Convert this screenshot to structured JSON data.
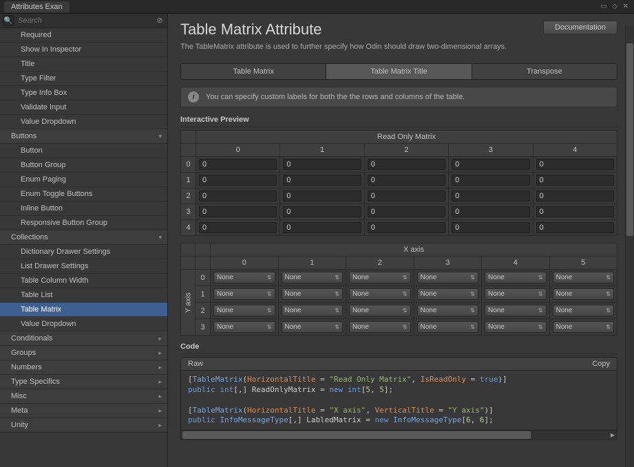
{
  "window": {
    "title": "Attributes Exan"
  },
  "search": {
    "placeholder": "Search"
  },
  "sidebar": {
    "topItems": [
      "Required",
      "Show In Inspector",
      "Title",
      "Type Filter",
      "Type Info Box",
      "Validate Input",
      "Value Dropdown"
    ],
    "groups": [
      {
        "name": "Buttons",
        "arrow": "▾",
        "items": [
          "Button",
          "Button Group",
          "Enum Paging",
          "Enum Toggle Buttons",
          "Inline Button",
          "Responsive Button Group"
        ]
      },
      {
        "name": "Collections",
        "arrow": "▾",
        "items": [
          "Dictionary Drawer Settings",
          "List Drawer Settings",
          "Table Column Width",
          "Table List",
          "Table Matrix",
          "Value Dropdown"
        ]
      },
      {
        "name": "Conditionals",
        "arrow": "▸",
        "items": []
      },
      {
        "name": "Groups",
        "arrow": "▸",
        "items": []
      },
      {
        "name": "Numbers",
        "arrow": "▸",
        "items": []
      },
      {
        "name": "Type Specifics",
        "arrow": "▸",
        "items": []
      },
      {
        "name": "Misc",
        "arrow": "▸",
        "items": []
      },
      {
        "name": "Meta",
        "arrow": "▸",
        "items": []
      },
      {
        "name": "Unity",
        "arrow": "▸",
        "items": []
      }
    ],
    "selected": "Table Matrix"
  },
  "page": {
    "title": "Table Matrix Attribute",
    "docBtn": "Documentation",
    "desc": "The TableMatrix attribute is used to further specify how Odin should draw two-dimensional arrays.",
    "tabs": [
      "Table Matrix",
      "Table Matrix Title",
      "Transpose"
    ],
    "activeTab": 1,
    "info": "You can specify custom labels for both the the rows and columns of the table.",
    "previewTitle": "Interactive Preview",
    "codeTitle": "Code",
    "raw": "Raw",
    "copy": "Copy"
  },
  "matrix1": {
    "title": "Read Only Matrix",
    "cols": [
      "0",
      "1",
      "2",
      "3",
      "4"
    ],
    "rows": [
      "0",
      "1",
      "2",
      "3",
      "4"
    ],
    "cells": [
      [
        "0",
        "0",
        "0",
        "0",
        "0"
      ],
      [
        "0",
        "0",
        "0",
        "0",
        "0"
      ],
      [
        "0",
        "0",
        "0",
        "0",
        "0"
      ],
      [
        "0",
        "0",
        "0",
        "0",
        "0"
      ],
      [
        "0",
        "0",
        "0",
        "0",
        "0"
      ]
    ]
  },
  "matrix2": {
    "htitle": "X axis",
    "vtitle": "Y axis",
    "cols": [
      "0",
      "1",
      "2",
      "3",
      "4",
      "5"
    ],
    "rows": [
      "0",
      "1",
      "2",
      "3"
    ],
    "cellLabel": "None"
  },
  "code": {
    "l1a": "[",
    "l1b": "TableMatrix",
    "l1c": "(",
    "l1d": "HorizontalTitle",
    "l1e": " = ",
    "l1f": "\"Read Only Matrix\"",
    "l1g": ", ",
    "l1h": "IsReadOnly",
    "l1i": " = ",
    "l1j": "true",
    "l1k": ")]",
    "l2a": "public ",
    "l2b": "int",
    "l2c": "[,] ReadOnlyMatrix = ",
    "l2d": "new ",
    "l2e": "int",
    "l2f": "[",
    "l2g": "5",
    "l2h": ", ",
    "l2i": "5",
    "l2j": "];",
    "l3": "",
    "l4a": "[",
    "l4b": "TableMatrix",
    "l4c": "(",
    "l4d": "HorizontalTitle",
    "l4e": " = ",
    "l4f": "\"X axis\"",
    "l4g": ", ",
    "l4h": "VerticalTitle",
    "l4i": " = ",
    "l4j": "\"Y axis\"",
    "l4k": ")]",
    "l5a": "public ",
    "l5b": "InfoMessageType",
    "l5c": "[,] LabledMatrix = ",
    "l5d": "new ",
    "l5e": "InfoMessageType",
    "l5f": "[",
    "l5g": "6",
    "l5h": ", ",
    "l5i": "6",
    "l5j": "];"
  }
}
